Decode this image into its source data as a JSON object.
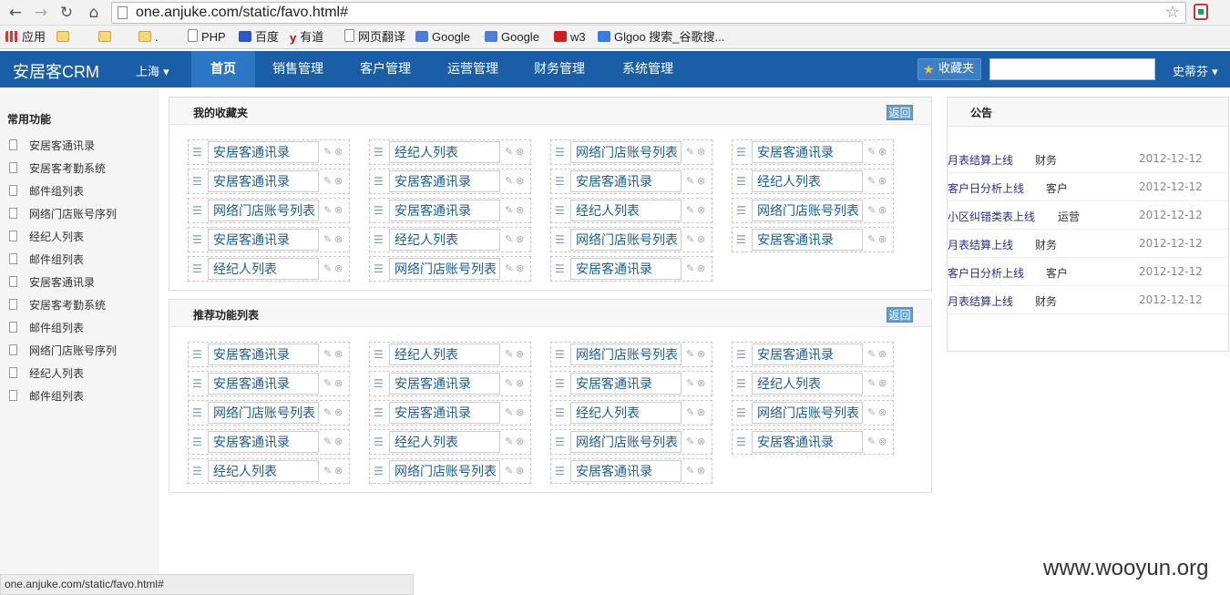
{
  "browser": {
    "url": "one.anjuke.com/static/favo.html#",
    "back": "←",
    "forward": "→",
    "reload": "↻",
    "home": "⌂",
    "star": "☆",
    "icons": {
      "back": "arrow-left-icon",
      "forward": "arrow-right-icon",
      "reload": "reload-icon",
      "home": "home-icon",
      "star": "star-icon"
    }
  },
  "bookmarks": [
    {
      "label": "应用",
      "icon": "apps-grid-icon"
    },
    {
      "label": "",
      "icon": "folder-icon"
    },
    {
      "label": "",
      "icon": "folder-icon"
    },
    {
      "label": ".",
      "icon": "folder-icon"
    },
    {
      "label": "PHP",
      "icon": "page-icon"
    },
    {
      "label": "百度",
      "icon": "baidu-icon"
    },
    {
      "label": "有道",
      "icon": "youdao-icon"
    },
    {
      "label": "网页翻译",
      "icon": "page-icon"
    },
    {
      "label": "Google",
      "icon": "google-icon"
    },
    {
      "label": "Google",
      "icon": "google-icon"
    },
    {
      "label": "w3",
      "icon": "w3-icon"
    },
    {
      "label": "Glgoo 搜索_谷歌搜...",
      "icon": "search-icon"
    }
  ],
  "topnav": {
    "brand": "安居客CRM",
    "city": "上海 ▾",
    "items": [
      {
        "label": "首页",
        "active": true
      },
      {
        "label": "销售管理",
        "active": false
      },
      {
        "label": "客户管理",
        "active": false
      },
      {
        "label": "运营管理",
        "active": false
      },
      {
        "label": "财务管理",
        "active": false
      },
      {
        "label": "系统管理",
        "active": false
      }
    ],
    "favorites_button": "收藏夹",
    "search_value": "",
    "user": "史蒂芬 ▾"
  },
  "sidebar": {
    "title": "常用功能",
    "items": [
      "安居客通讯录",
      "安居客考勤系统",
      "邮件组列表",
      "网络门店账号序列",
      "经纪人列表",
      "邮件组列表",
      "安居客通讯录",
      "安居客考勤系统",
      "邮件组列表",
      "网络门店账号序列",
      "经纪人列表",
      "邮件组列表"
    ]
  },
  "favorites": {
    "title": "我的收藏夹",
    "back": "返回",
    "tiles": [
      "安居客通讯录",
      "经纪人列表",
      "网络门店账号列表",
      "安居客通讯录",
      "安居客通讯录",
      "安居客通讯录",
      "安居客通讯录",
      "经纪人列表",
      "网络门店账号列表",
      "安居客通讯录",
      "经纪人列表",
      "网络门店账号列表",
      "安居客通讯录",
      "经纪人列表",
      "网络门店账号列表",
      "安居客通讯录",
      "经纪人列表",
      "网络门店账号列表",
      "安居客通讯录"
    ]
  },
  "recommended": {
    "title": "推荐功能列表",
    "back": "返回",
    "tiles": [
      "安居客通讯录",
      "经纪人列表",
      "网络门店账号列表",
      "安居客通讯录",
      "安居客通讯录",
      "安居客通讯录",
      "安居客通讯录",
      "经纪人列表",
      "网络门店账号列表",
      "安居客通讯录",
      "经纪人列表",
      "网络门店账号列表",
      "安居客通讯录",
      "经纪人列表",
      "网络门店账号列表",
      "安居客通讯录",
      "经纪人列表",
      "网络门店账号列表",
      "安居客通讯录"
    ]
  },
  "notice": {
    "title": "公告",
    "rows": [
      {
        "title": "月表结算上线",
        "category": "财务",
        "date": "2012-12-12"
      },
      {
        "title": "客户日分析上线",
        "category": "客户",
        "date": "2012-12-12"
      },
      {
        "title": "小区纠错类表上线",
        "category": "运营",
        "date": "2012-12-12"
      },
      {
        "title": "月表结算上线",
        "category": "财务",
        "date": "2012-12-12"
      },
      {
        "title": "客户日分析上线",
        "category": "客户",
        "date": "2012-12-12"
      },
      {
        "title": "月表结算上线",
        "category": "财务",
        "date": "2012-12-12"
      }
    ]
  },
  "status_bar": "one.anjuke.com/static/favo.html#",
  "watermark": "www.wooyun.org",
  "colors": {
    "nav": "#1a5ea8",
    "nav_active": "#2d76c4",
    "link": "#1a5e95",
    "notice_link": "#2a2f8a"
  }
}
